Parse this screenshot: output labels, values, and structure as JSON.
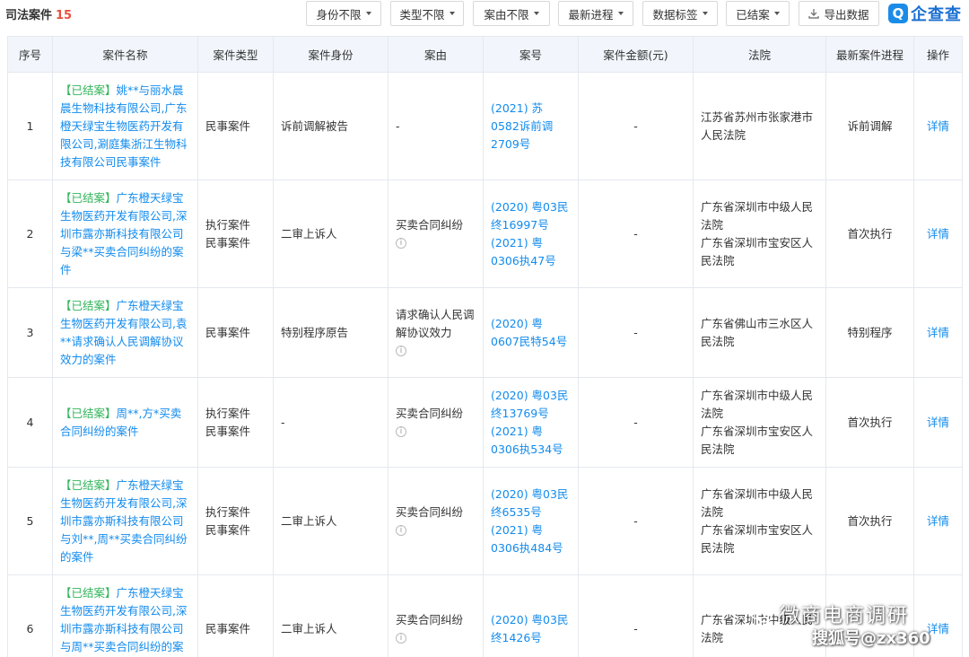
{
  "header": {
    "title": "司法案件",
    "count": "15",
    "filters": [
      "身份不限",
      "类型不限",
      "案由不限",
      "最新进程",
      "数据标签",
      "已结案"
    ],
    "export_label": "导出数据",
    "logo_mark": "Q",
    "logo_text": "企查查"
  },
  "table": {
    "columns": [
      "序号",
      "案件名称",
      "案件类型",
      "案件身份",
      "案由",
      "案号",
      "案件金额(元)",
      "法院",
      "最新案件进程",
      "操作"
    ],
    "rows": [
      {
        "no": "1",
        "status": "【已结案】",
        "title": "姚**与丽水晨晨生物科技有限公司,广东橙天绿宝生物医药开发有限公司,涮庭集浙江生物科技有限公司民事案件",
        "type": "民事案件",
        "role": "诉前调解被告",
        "reason": "-",
        "case_no": "(2021) 苏0582诉前调2709号",
        "amount": "-",
        "court": "江苏省苏州市张家港市人民法院",
        "progress": "诉前调解",
        "action": "详情"
      },
      {
        "no": "2",
        "status": "【已结案】",
        "title": "广东橙天绿宝生物医药开发有限公司,深圳市露亦斯科技有限公司与梁**买卖合同纠纷的案件",
        "type": "执行案件\n民事案件",
        "role": "二审上诉人",
        "reason": "买卖合同纠纷",
        "case_no": "(2020) 粤03民终16997号\n(2021) 粤0306执47号",
        "amount": "-",
        "court": "广东省深圳市中级人民法院\n广东省深圳市宝安区人民法院",
        "progress": "首次执行",
        "action": "详情"
      },
      {
        "no": "3",
        "status": "【已结案】",
        "title": "广东橙天绿宝生物医药开发有限公司,袁**请求确认人民调解协议效力的案件",
        "type": "民事案件",
        "role": "特别程序原告",
        "reason": "请求确认人民调解协议效力",
        "case_no": "(2020) 粤0607民特54号",
        "amount": "-",
        "court": "广东省佛山市三水区人民法院",
        "progress": "特别程序",
        "action": "详情"
      },
      {
        "no": "4",
        "status": "【已结案】",
        "title": "周**,方*买卖合同纠纷的案件",
        "type": "执行案件\n民事案件",
        "role": "-",
        "reason": "买卖合同纠纷",
        "case_no": "(2020) 粤03民终13769号\n(2021) 粤0306执534号",
        "amount": "-",
        "court": "广东省深圳市中级人民法院\n广东省深圳市宝安区人民法院",
        "progress": "首次执行",
        "action": "详情"
      },
      {
        "no": "5",
        "status": "【已结案】",
        "title": "广东橙天绿宝生物医药开发有限公司,深圳市露亦斯科技有限公司与刘**,周**买卖合同纠纷的案件",
        "type": "执行案件\n民事案件",
        "role": "二审上诉人",
        "reason": "买卖合同纠纷",
        "case_no": "(2020) 粤03民终6535号\n(2021) 粤0306执484号",
        "amount": "-",
        "court": "广东省深圳市中级人民法院\n广东省深圳市宝安区人民法院",
        "progress": "首次执行",
        "action": "详情"
      },
      {
        "no": "6",
        "status": "【已结案】",
        "title": "广东橙天绿宝生物医药开发有限公司,深圳市露亦斯科技有限公司与周**买卖合同纠纷的案件",
        "type": "民事案件",
        "role": "二审上诉人",
        "reason": "买卖合同纠纷",
        "case_no": "(2020) 粤03民终1426号",
        "amount": "-",
        "court": "广东省深圳市中级人民法院",
        "progress": "",
        "action": "详情"
      }
    ]
  },
  "watermark": {
    "line1": "微商电商调研",
    "line2": "搜狐号@zx360"
  },
  "colors": {
    "status_green": "#31b55a",
    "link_blue": "#128bed",
    "count_red": "#e84f3f",
    "header_bg": "#f2f6fc"
  }
}
